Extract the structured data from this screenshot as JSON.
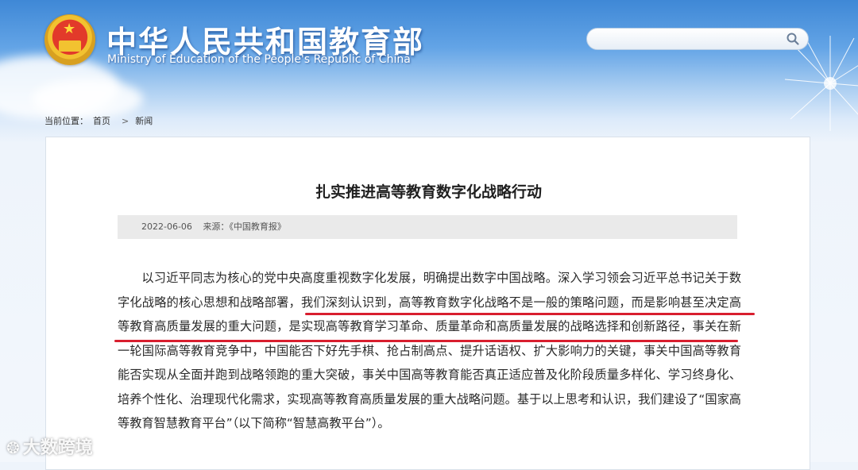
{
  "header": {
    "title_cn": "中华人民共和国教育部",
    "title_en": "Ministry of Education of the People's Republic of China",
    "search_placeholder": "",
    "search_icon": "search-icon"
  },
  "breadcrumb": {
    "prefix": "当前位置：",
    "items": [
      "首页",
      "新闻"
    ],
    "separator": ">"
  },
  "article": {
    "title": "扎实推进高等教育数字化战略行动",
    "date": "2022-06-06",
    "source": "来源：《中国教育报》",
    "body": "以习近平同志为核心的党中央高度重视数字化发展，明确提出数字中国战略。深入学习领会习近平总书记关于数字化战略的核心思想和战略部署，我们深刻认识到，高等教育数字化战略不是一般的策略问题，而是影响甚至决定高等教育高质量发展的重大问题，是实现高等教育学习革命、质量革命和高质量发展的战略选择和创新路径，事关在新一轮国际高等教育竞争中，中国能否下好先手棋、抢占制高点、提升话语权、扩大影响力的关键，事关中国高等教育能否实现从全面并跑到战略领跑的重大突破，事关中国高等教育能否真正适应普及化阶段质量多样化、学习终身化、培养个性化、治理现代化需求，实现高等教育高质量发展的重大战略问题。基于以上思考和认识，我们建设了“国家高等教育智慧教育平台”（以下简称“智慧高教平台”）。"
  },
  "watermark": {
    "text": "大数跨境"
  },
  "colors": {
    "highlight_underline": "#d81e2e",
    "header_blue": "#3f88d6"
  }
}
